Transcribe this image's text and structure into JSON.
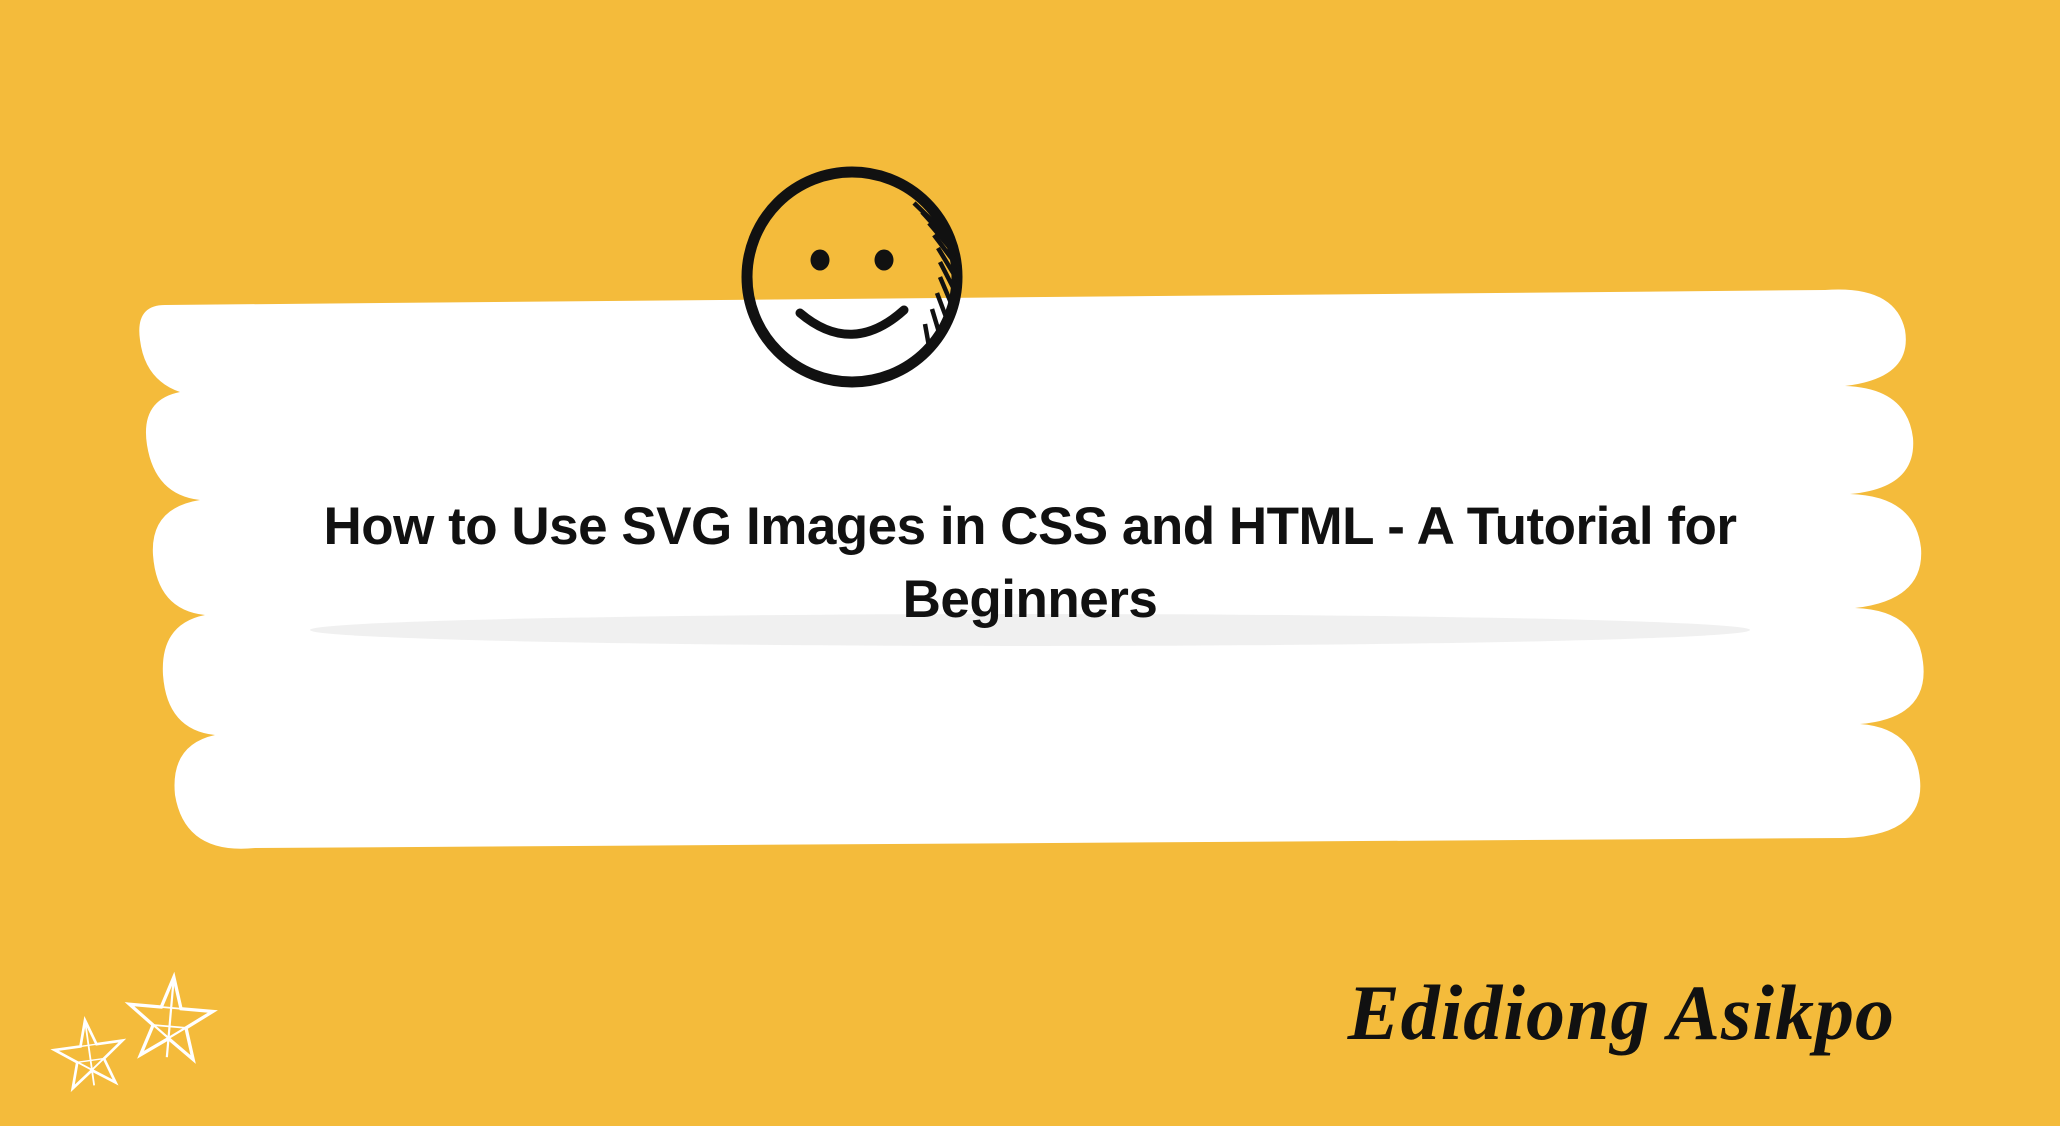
{
  "title": "How to Use SVG Images in CSS and HTML - A Tutorial for Beginners",
  "author": "Edidiong Asikpo",
  "colors": {
    "background": "#f4bb3b",
    "brush": "#ffffff",
    "text": "#111111"
  },
  "icons": {
    "smiley": "smiley-face-icon",
    "stars": "double-star-icon"
  }
}
